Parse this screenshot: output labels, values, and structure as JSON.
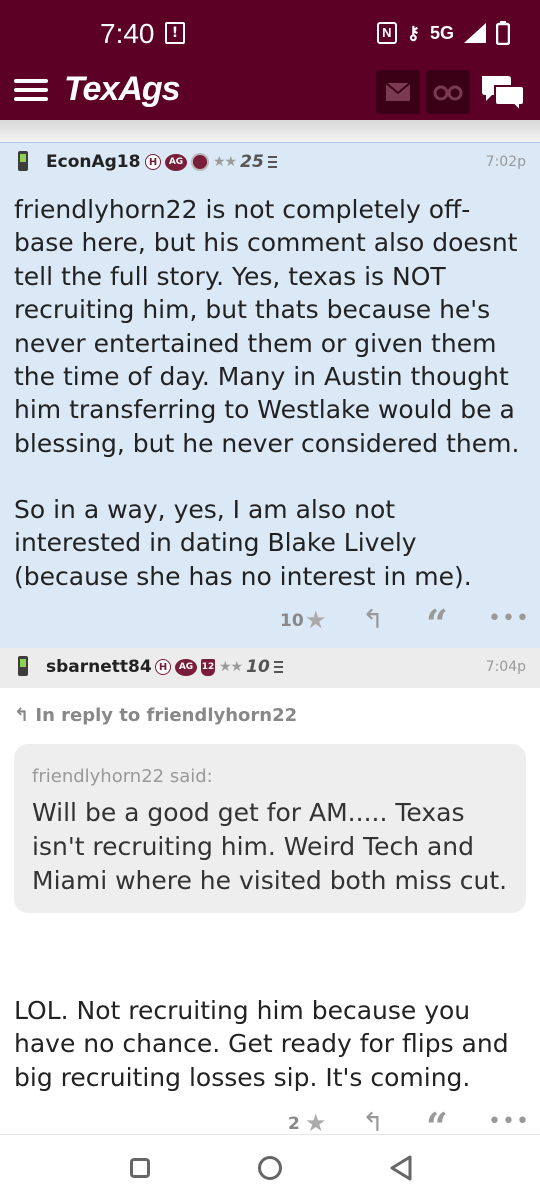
{
  "status": {
    "time": "7:40",
    "network": "5G"
  },
  "app": {
    "logo": "TexAgs",
    "colors": {
      "brand": "#5c0026",
      "post_highlight": "#dbe8f6"
    }
  },
  "icons": [
    "menu-icon",
    "mail-icon",
    "binoculars-icon",
    "chat-icon",
    "star-icon",
    "reply-icon",
    "quote-icon",
    "more-icon"
  ],
  "post1": {
    "username": "EconAg18",
    "badges": {
      "h": "H",
      "ag": "AG",
      "stars": "★★",
      "level": "25"
    },
    "time": "7:02p",
    "paragraphs": [
      "friendlyhorn22 is not completely off-base here, but his comment also doesnt tell the full story. Yes, texas is NOT recruiting him, but thats because he's never entertained them or given them the time of day. Many in Austin thought him transferring to Westlake would be a blessing, but he never considered them.",
      "So in a way, yes, I am also not interested in dating Blake Lively (because she has no interest in me)."
    ],
    "likes": "10"
  },
  "post2": {
    "username": "sbarnett84",
    "badges": {
      "h": "H",
      "ag": "AG",
      "shield": "12",
      "stars": "★★",
      "level": "10"
    },
    "time": "7:04p",
    "in_reply_to": "In reply to friendlyhorn22",
    "quote_author": "friendlyhorn22 said:",
    "quote_text": "Will be a good get for AM..... Texas isn't recruiting him. Weird Tech and Miami where he visited both miss cut.",
    "body": "LOL. Not recruiting him because you have no chance. Get ready for flips and big recruiting losses sip. It's coming.",
    "likes": "2"
  }
}
